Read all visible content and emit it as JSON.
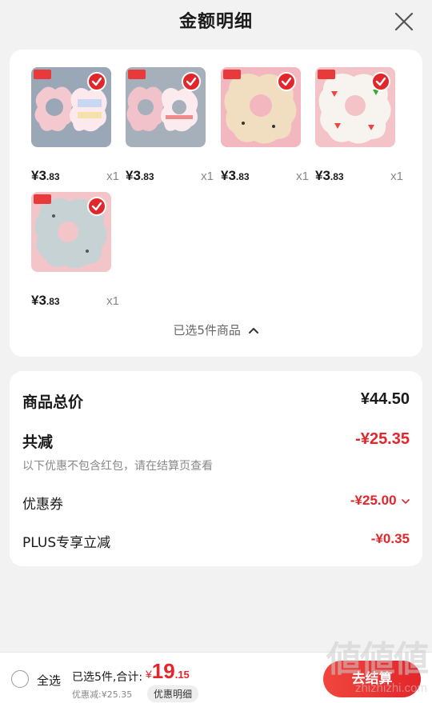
{
  "header": {
    "title": "金额明细"
  },
  "products": [
    {
      "price_int": "¥3",
      "price_dec": ".83",
      "qty": "x1",
      "icon": "bib-pink-pair"
    },
    {
      "price_int": "¥3",
      "price_dec": ".83",
      "qty": "x1",
      "icon": "bib-pink-pair"
    },
    {
      "price_int": "¥3",
      "price_dec": ".83",
      "qty": "x1",
      "icon": "bib-beige-flower"
    },
    {
      "price_int": "¥3",
      "price_dec": ".83",
      "qty": "x1",
      "icon": "bib-watermelon"
    },
    {
      "price_int": "¥3",
      "price_dec": ".83",
      "qty": "x1",
      "icon": "bib-grey-flower"
    }
  ],
  "selected_toggle": "已选5件商品",
  "summary": {
    "goods_total_label": "商品总价",
    "goods_total_value": "¥44.50",
    "reduction_label": "共减",
    "reduction_value": "-¥25.35",
    "reduction_note": "以下优惠不包含红包，请在结算页查看",
    "coupon_label": "优惠券",
    "coupon_value": "-¥25.00",
    "plus_label": "PLUS专享立减",
    "plus_value": "-¥0.35"
  },
  "bottom_bar": {
    "select_all": "全选",
    "selected_total_label": "已选5件,合计:",
    "total_symbol": "¥",
    "total_int": "19",
    "total_dec": ".15",
    "discount_note": "优惠减:¥25.35",
    "detail_button": "优惠明细",
    "checkout_button": "去结算"
  },
  "watermark": {
    "text": "zhizhizhi.com"
  },
  "colors": {
    "accent_red": "#e3262b",
    "background": "#f2f2f2"
  }
}
